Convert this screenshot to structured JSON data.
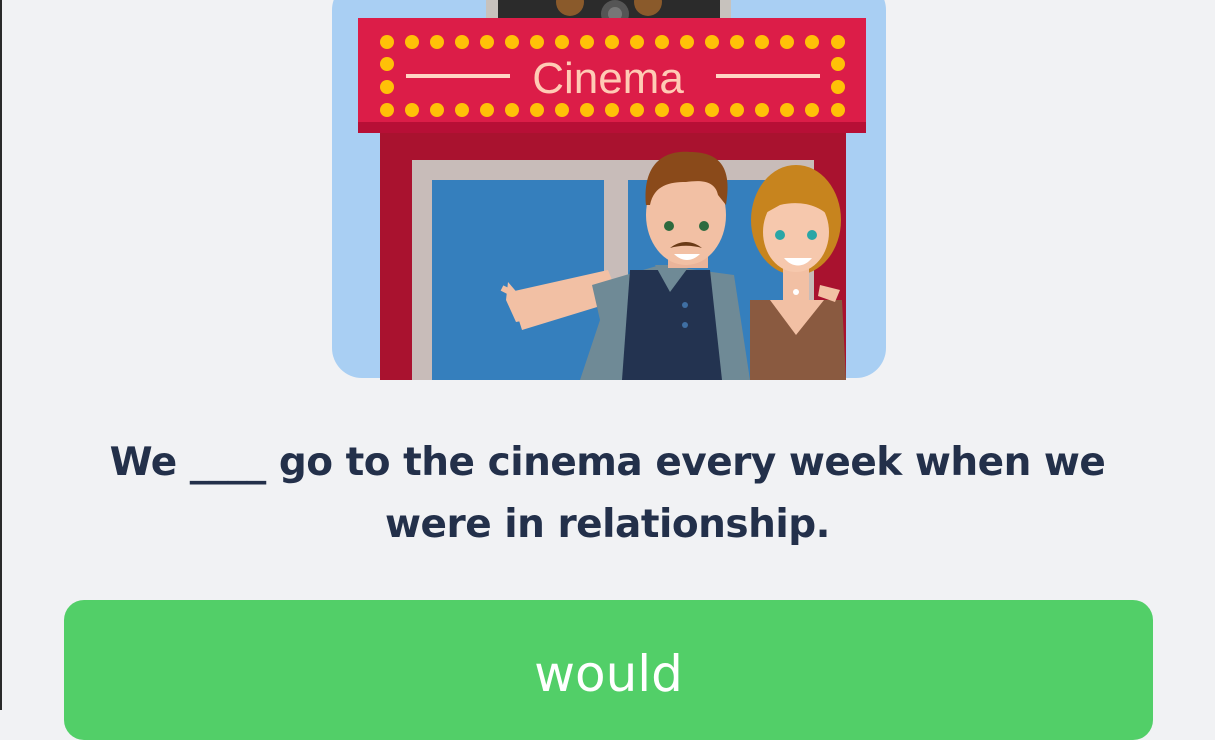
{
  "illustration": {
    "sign_text": "Cinema",
    "colors": {
      "sky": "#a9cff3",
      "sign": "#dc1d48",
      "bulb": "#ffc107",
      "wall": "#a9122f",
      "window": "#357fbd",
      "frame": "#c8bcb9"
    }
  },
  "question": {
    "text": "We ____ go to the cinema every week when we were in relationship."
  },
  "answer": {
    "label": "would",
    "color": "#52cf68"
  }
}
